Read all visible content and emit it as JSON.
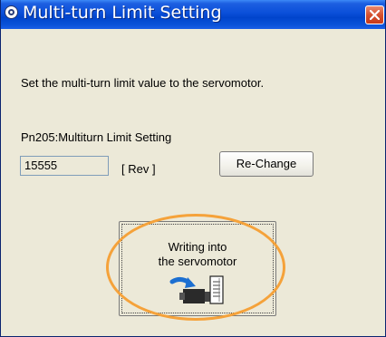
{
  "window": {
    "title": "Multi-turn Limit Setting",
    "close_label": "✕"
  },
  "instruction": "Set the multi-turn limit value to the servomotor.",
  "parameter": {
    "label": "Pn205:Multiturn Limit Setting",
    "value": "15555",
    "unit": "[ Rev ]"
  },
  "buttons": {
    "rechange": "Re-Change",
    "write_line1": "Writing into",
    "write_line2": "the servomotor"
  },
  "icons": {
    "title": "app-icon",
    "write": "servomotor-write-icon",
    "highlight_color": "#f5a23a"
  }
}
